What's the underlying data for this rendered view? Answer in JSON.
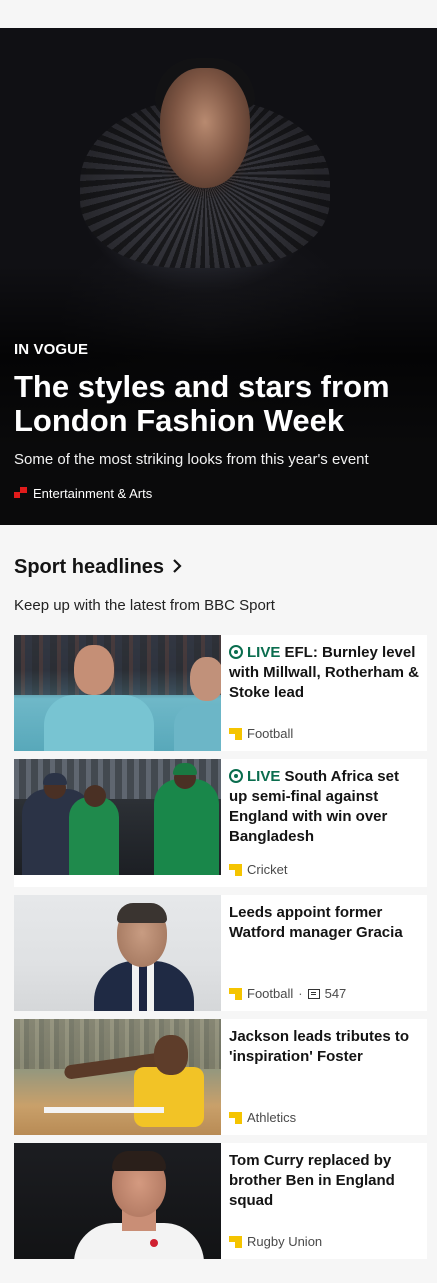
{
  "hero": {
    "kicker": "IN VOGUE",
    "title": "The styles and stars from London Fashion Week",
    "summary": "Some of the most striking looks from this year's event",
    "topic": "Entertainment & Arts",
    "topic_icon": "bbc-news-topic-icon"
  },
  "sport": {
    "title": "Sport headlines",
    "subtitle": "Keep up with the latest from BBC Sport",
    "chevron": "›",
    "items": [
      {
        "live": true,
        "live_label": "LIVE",
        "headline": "EFL: Burnley level with Millwall, Rotherham & Stoke lead",
        "topic": "Football"
      },
      {
        "live": true,
        "live_label": "LIVE",
        "headline": "South Africa set up semi-final against England with win over Bangladesh",
        "topic": "Cricket"
      },
      {
        "live": false,
        "headline": "Leeds appoint former Watford manager Gracia",
        "topic": "Football",
        "comments": "547"
      },
      {
        "live": false,
        "headline": "Jackson leads tributes to 'inspiration' Foster",
        "topic": "Athletics"
      },
      {
        "live": false,
        "headline": "Tom Curry replaced by brother Ben in England squad",
        "topic": "Rugby Union"
      }
    ]
  },
  "colors": {
    "live": "#0a6d4e",
    "news_red": "#e01b1b",
    "sport_yellow": "#f5c400"
  }
}
